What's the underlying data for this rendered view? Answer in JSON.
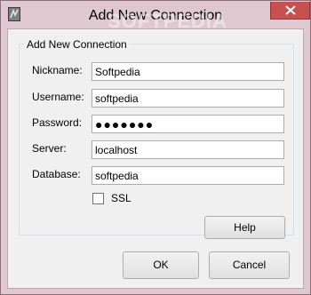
{
  "window": {
    "title": "Add New Connection",
    "icon": "app-icon",
    "close_icon": "close-icon",
    "accent_close": "#c75050"
  },
  "watermark": "SOFTPEDIA",
  "group": {
    "legend": "Add New Connection"
  },
  "form": {
    "nickname_label": "Nickname:",
    "nickname_value": "Softpedia",
    "username_label": "Username:",
    "username_value": "softpedia",
    "password_label": "Password:",
    "password_value": "●●●●●●●",
    "server_label": "Server:",
    "server_value": "localhost",
    "database_label": "Database:",
    "database_value": "softpedia",
    "ssl_label": "SSL",
    "ssl_checked": false
  },
  "buttons": {
    "help": "Help",
    "ok": "OK",
    "cancel": "Cancel"
  }
}
